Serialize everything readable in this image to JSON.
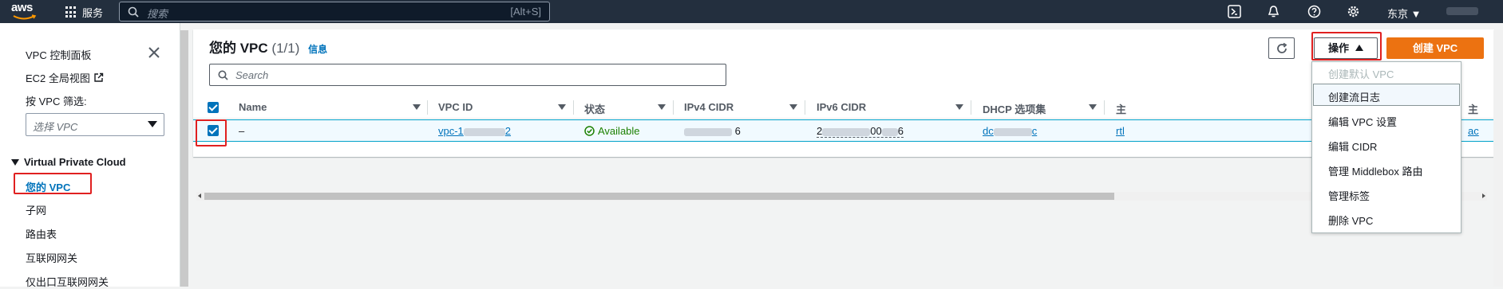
{
  "topbar": {
    "logo_text": "aws",
    "services_label": "服务",
    "search_placeholder": "搜索",
    "search_shortcut": "[Alt+S]",
    "region_label": "东京 ▼"
  },
  "sidebar": {
    "vpc_dashboard": "VPC 控制面板",
    "ec2_global_view": "EC2 全局视图",
    "filter_by_vpc_label": "按 VPC 筛选:",
    "filter_placeholder": "选择 VPC",
    "section_title": "Virtual Private Cloud",
    "items": [
      {
        "label": "您的 VPC",
        "active": true
      },
      {
        "label": "子网"
      },
      {
        "label": "路由表"
      },
      {
        "label": "互联网网关"
      },
      {
        "label": "仅出口互联网网关"
      }
    ]
  },
  "main": {
    "title": "您的 VPC",
    "count": "(1/1)",
    "info_link": "信息",
    "actions_label": "操作",
    "create_label": "创建 VPC",
    "search_placeholder": "Search",
    "columns": [
      "Name",
      "VPC ID",
      "状态",
      "IPv4 CIDR",
      "IPv6 CIDR",
      "DHCP 选项集",
      "主",
      "主"
    ],
    "row": {
      "name": "–",
      "vpc_id": "vpc-1",
      "vpc_id_tail": "2",
      "status": "Available",
      "ipv4_tail": "6",
      "ipv6_head": "2",
      "ipv6_mid": "00",
      "ipv6_tail": "6",
      "dhcp": "dc",
      "dhcp_tail": "c",
      "route": "rtl",
      "col8": "ac"
    }
  },
  "actions_menu": {
    "items": [
      {
        "label": "创建默认 VPC",
        "disabled": true
      },
      {
        "label": "创建流日志"
      },
      {
        "label": "编辑 VPC 设置"
      },
      {
        "label": "编辑 CIDR"
      },
      {
        "label": "管理 Middlebox 路由"
      },
      {
        "label": "管理标签"
      },
      {
        "label": "删除 VPC"
      }
    ]
  },
  "colors": {
    "accent": "#0073bb",
    "primary_button": "#ec7211",
    "highlight_box": "#e02020",
    "status_available": "#1d8102"
  }
}
